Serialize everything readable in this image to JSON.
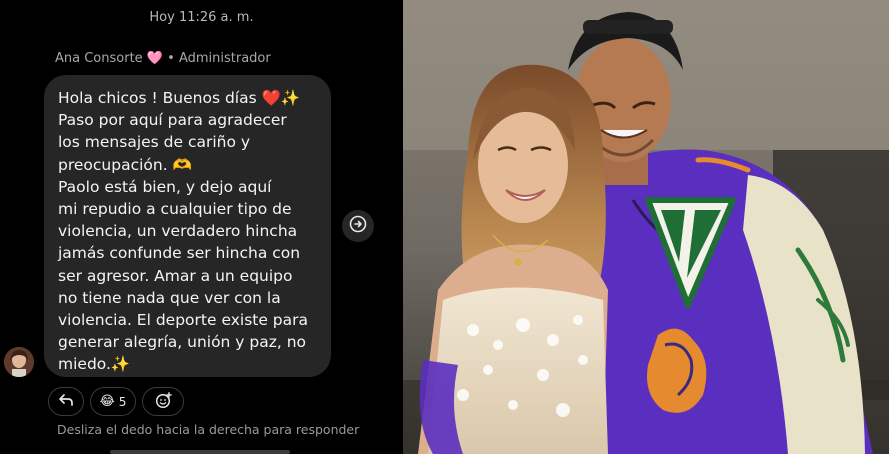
{
  "chat": {
    "timestamp": "Hoy 11:26 a. m.",
    "sender_name": "Ana Consorte",
    "sender_heart": "🩷",
    "sender_role": "• Administrador",
    "message_lines": [
      "Hola chicos ! Buenos días ❤️✨",
      "Paso por aquí para agradecer",
      "los mensajes de cariño y",
      "preocupación. 🫶",
      "Paolo está bien, y dejo aquí",
      "mi repudio a cualquier tipo de",
      "violencia, un verdadero hincha",
      "jamás confunde ser hincha con",
      "ser agresor. Amar a un equipo",
      "no tiene nada que ver con la",
      "violencia. El deporte existe para",
      "generar alegría, unión y paz, no",
      "miedo.✨"
    ],
    "reaction_emoji": "😂",
    "reaction_count": "5",
    "swipe_hint": "Desliza el dedo hacia la derecha para responder"
  },
  "icons": {
    "reply": "reply-arrow-icon",
    "add_reaction": "add-reaction-icon",
    "forward": "share-forward-icon"
  },
  "photo": {
    "jacket_letter": "V"
  },
  "colors": {
    "background": "#000000",
    "bubble": "#262626",
    "jacket": "#5a2fbf",
    "sleeve": "#e8e2c8"
  }
}
